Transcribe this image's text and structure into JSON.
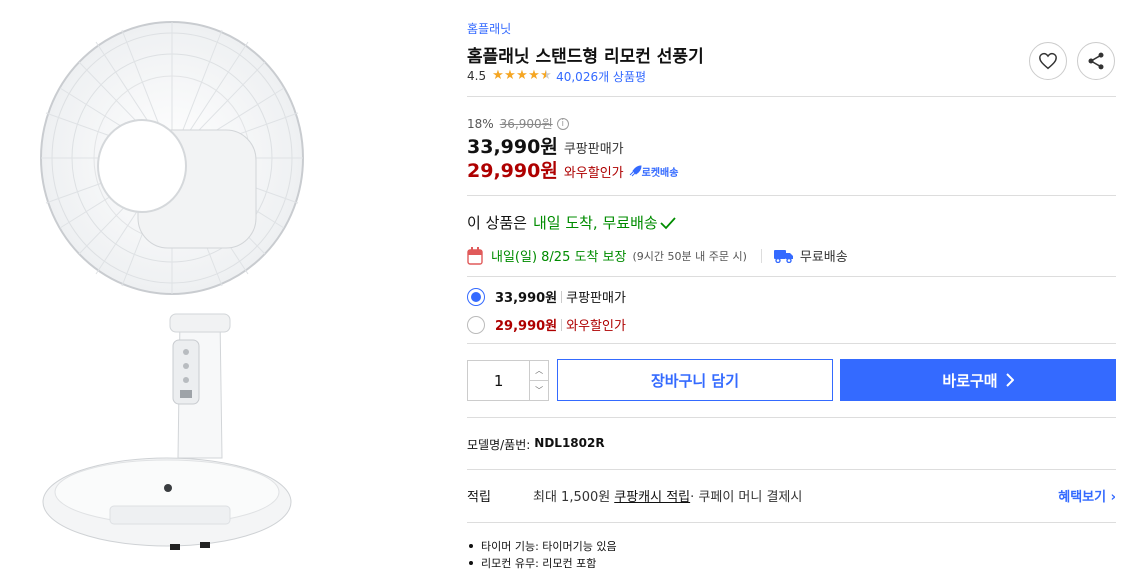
{
  "product": {
    "brand": "홈플래닛",
    "title": "홈플래닛 스탠드형 리모컨 선풍기",
    "rating": "4.5",
    "star_count": 4.5,
    "review_count": "40,026개 상품평"
  },
  "price": {
    "discount": "18%",
    "original": "36,900원",
    "sale": "33,990원",
    "sale_label": "쿠팡판매가",
    "wow": "29,990원",
    "wow_label": "와우할인가",
    "rocket": "로켓배송"
  },
  "delivery": {
    "headline_prefix": "이 상품은",
    "headline_highlight": "내일 도착, 무료배송",
    "date": "내일(일) 8/25 도착 보장",
    "note": "(9시간 50분 내 주문 시)",
    "free_shipping": "무료배송"
  },
  "options": [
    {
      "price": "33,990원",
      "label": "쿠팡판매가",
      "selected": true
    },
    {
      "price": "29,990원",
      "label": "와우할인가",
      "selected": false
    }
  ],
  "purchase": {
    "quantity": "1",
    "cart_label": "장바구니 담기",
    "buy_label": "바로구매"
  },
  "model": {
    "label": "모델명/품번:",
    "value": "NDL1802R"
  },
  "reward": {
    "label": "적립",
    "prefix": "최대 1,500원",
    "link": "쿠팡캐시 적립",
    "suffix": " · 쿠페이 머니 결제시",
    "benefit": "혜택보기"
  },
  "bullets": [
    "타이머 기능: 타이머기능 있음",
    "리모컨 유무: 리모컨 포함"
  ],
  "colors": {
    "accent": "#346aff",
    "wow": "#ae0000",
    "green": "#008c00",
    "star": "#f5a623"
  }
}
